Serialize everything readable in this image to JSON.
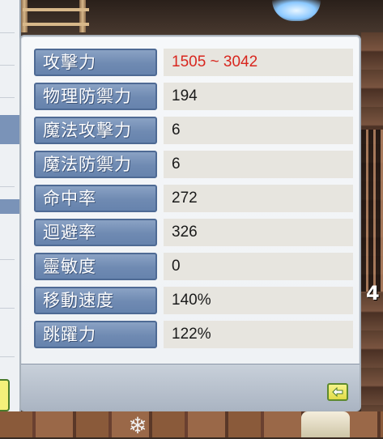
{
  "stats_window": {
    "rows": [
      {
        "label": "攻擊力",
        "value": "1505 ~ 3042"
      },
      {
        "label": "物理防禦力",
        "value": "194"
      },
      {
        "label": "魔法攻擊力",
        "value": "6"
      },
      {
        "label": "魔法防禦力",
        "value": "6"
      },
      {
        "label": "命中率",
        "value": "272"
      },
      {
        "label": "迴避率",
        "value": "326"
      },
      {
        "label": "靈敏度",
        "value": "0"
      },
      {
        "label": "移動速度",
        "value": "140%"
      },
      {
        "label": "跳躍力",
        "value": "122%"
      }
    ],
    "back_button_icon": "arrow-left-icon"
  },
  "background": {
    "right_number": "4"
  },
  "colors": {
    "label_bg": "#6f8ab2",
    "value_bg": "#e7e5df",
    "attack_value": "#d8261e",
    "back_button": "#e2dc48"
  }
}
